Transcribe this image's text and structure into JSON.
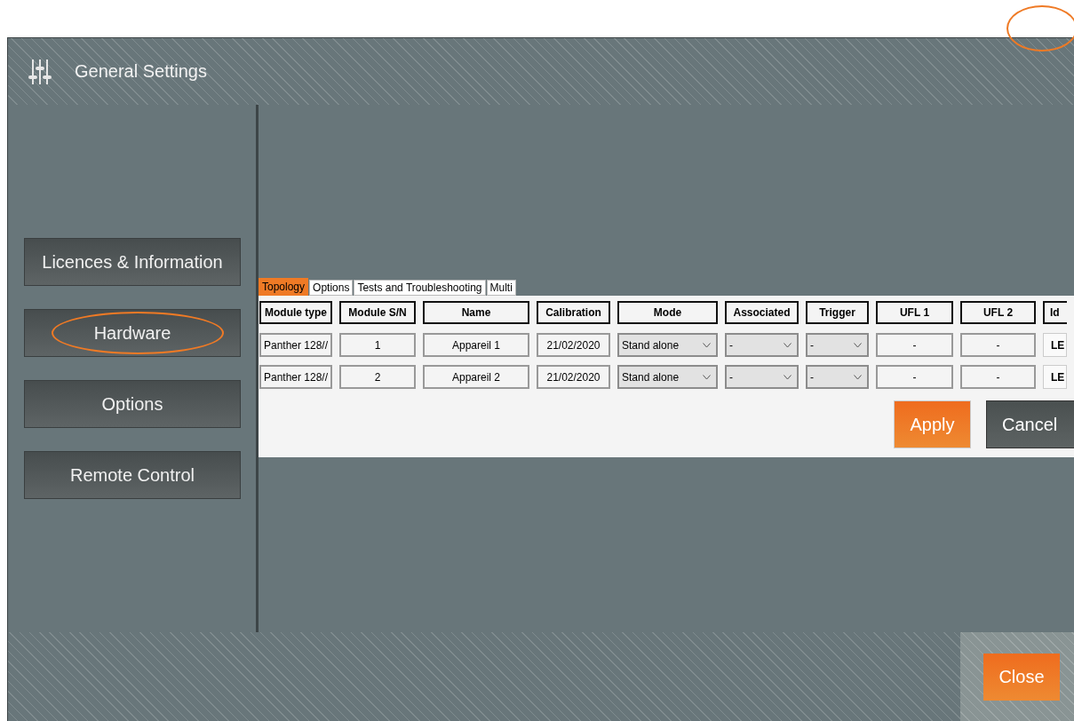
{
  "window": {
    "title": "General Settings",
    "corner_circled": true
  },
  "sidebar": {
    "items": [
      {
        "label": "Licences & Information",
        "circled": false
      },
      {
        "label": "Hardware",
        "circled": true
      },
      {
        "label": "Options",
        "circled": false
      },
      {
        "label": "Remote Control",
        "circled": false
      }
    ]
  },
  "tabs": [
    {
      "label": "Topology",
      "selected": true
    },
    {
      "label": "Options",
      "selected": false
    },
    {
      "label": "Tests and Troubleshooting",
      "selected": false
    },
    {
      "label": "Multi",
      "selected": false
    }
  ],
  "table": {
    "columns": [
      "Module type",
      "Module S/N",
      "Name",
      "Calibration",
      "Mode",
      "Associated",
      "Trigger",
      "UFL 1",
      "UFL 2",
      "Id"
    ],
    "rows": [
      [
        {
          "kind": "text",
          "value": "Panther 128//"
        },
        {
          "kind": "text",
          "value": "1"
        },
        {
          "kind": "text",
          "value": "Appareil 1"
        },
        {
          "kind": "text",
          "value": "21/02/2020"
        },
        {
          "kind": "select",
          "value": "Stand alone"
        },
        {
          "kind": "select",
          "value": "-"
        },
        {
          "kind": "select",
          "value": "-"
        },
        {
          "kind": "text",
          "value": "-"
        },
        {
          "kind": "text",
          "value": "-"
        },
        {
          "kind": "button",
          "value": "LE"
        }
      ],
      [
        {
          "kind": "text",
          "value": "Panther 128//"
        },
        {
          "kind": "text",
          "value": "2"
        },
        {
          "kind": "text",
          "value": "Appareil 2"
        },
        {
          "kind": "text",
          "value": "21/02/2020"
        },
        {
          "kind": "select",
          "value": "Stand alone"
        },
        {
          "kind": "select",
          "value": "-"
        },
        {
          "kind": "select",
          "value": "-"
        },
        {
          "kind": "text",
          "value": "-"
        },
        {
          "kind": "text",
          "value": "-"
        },
        {
          "kind": "button",
          "value": "LE"
        }
      ]
    ]
  },
  "buttons": [
    "Apply",
    "Cancel"
  ],
  "footer": {
    "button": "Close"
  }
}
